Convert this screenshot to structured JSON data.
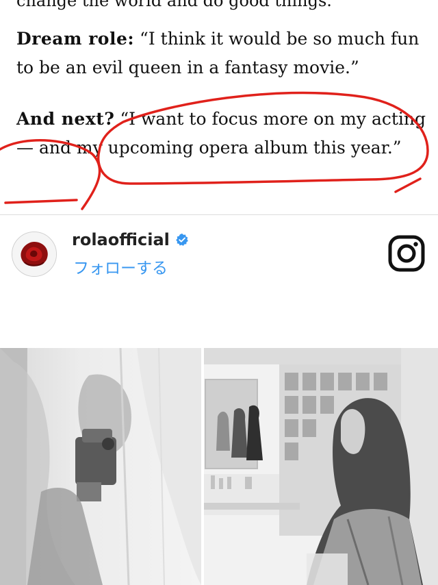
{
  "article": {
    "partial_line": "change the world and do good things.”",
    "dream_label": "Dream role:",
    "dream_text": "“I think it would be so much fun to be an evil queen in a fantasy movie.”",
    "next_label": "And next?",
    "next_text": "“I want to focus more on my acting — and my upcoming opera album this year.”"
  },
  "instagram": {
    "username": "rolaofficial",
    "follow_label": "フォローする",
    "icons": [
      "rose-avatar",
      "verified-badge-icon",
      "instagram-logo-icon"
    ]
  },
  "colors": {
    "annotation_red": "#e0211b",
    "follow_blue": "#3897f0",
    "verified_blue": "#3897f0"
  }
}
